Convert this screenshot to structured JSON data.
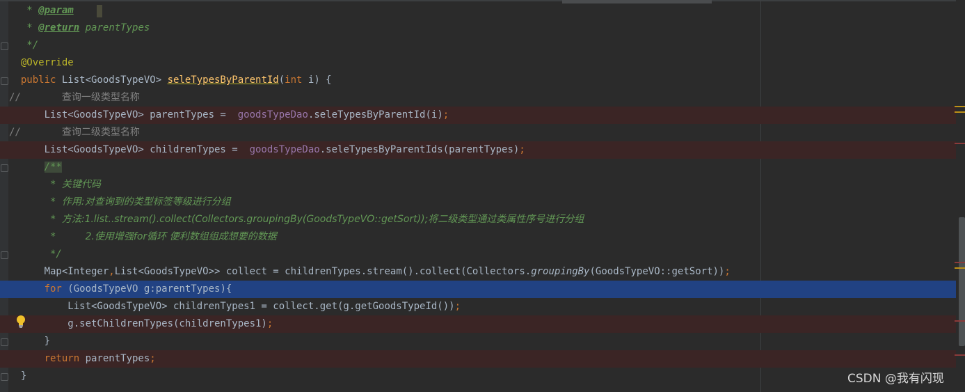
{
  "editor": {
    "lines": [
      {
        "id": "l1",
        "parts": [
          {
            "c": "doc",
            "t": "   * "
          },
          {
            "c": "doctag",
            "t": "@param"
          },
          {
            "c": "doc",
            "t": " "
          }
        ]
      },
      {
        "id": "l2",
        "parts": [
          {
            "c": "doc",
            "t": "   * "
          },
          {
            "c": "doctag",
            "t": "@return"
          },
          {
            "c": "doc",
            "t": " parentTypes"
          }
        ]
      },
      {
        "id": "l3",
        "parts": [
          {
            "c": "doc",
            "t": "   */"
          }
        ]
      },
      {
        "id": "l4",
        "parts": [
          {
            "c": "ann",
            "t": "  @Override"
          }
        ]
      },
      {
        "id": "l5",
        "parts": [
          {
            "c": "kw",
            "t": "  public "
          },
          {
            "c": "",
            "t": "List<GoodsTypeVO> "
          },
          {
            "c": "fn",
            "t": "seleTypesByParentId"
          },
          {
            "c": "",
            "t": "("
          },
          {
            "c": "kw",
            "t": "int "
          },
          {
            "c": "",
            "t": "i) {"
          }
        ]
      },
      {
        "id": "l6",
        "parts": [
          {
            "c": "cmt",
            "t": "//       "
          },
          {
            "c": "cmt cjk",
            "t": "查询一级类型名称"
          }
        ]
      },
      {
        "id": "l7",
        "err": true,
        "parts": [
          {
            "c": "",
            "t": "      List<GoodsTypeVO> parentTypes =  "
          },
          {
            "c": "fld",
            "t": "goodsTypeDao"
          },
          {
            "c": "",
            "t": ".seleTypesByParentId(i)"
          },
          {
            "c": "kw",
            "t": ";"
          }
        ]
      },
      {
        "id": "l8",
        "parts": [
          {
            "c": "cmt",
            "t": "//       "
          },
          {
            "c": "cmt cjk",
            "t": "查询二级类型名称"
          }
        ]
      },
      {
        "id": "l9",
        "err": true,
        "parts": [
          {
            "c": "",
            "t": "      List<GoodsTypeVO> childrenTypes =  "
          },
          {
            "c": "fld",
            "t": "goodsTypeDao"
          },
          {
            "c": "",
            "t": ".seleTypesByParentIds(parentTypes)"
          },
          {
            "c": "kw",
            "t": ";"
          }
        ]
      },
      {
        "id": "l10",
        "parts": [
          {
            "c": "",
            "t": "      "
          },
          {
            "c": "doc docbox",
            "t": "/**"
          }
        ]
      },
      {
        "id": "l11",
        "parts": [
          {
            "c": "doc",
            "t": "       * "
          },
          {
            "c": "doc cjk",
            "t": "关键代码"
          }
        ]
      },
      {
        "id": "l12",
        "parts": [
          {
            "c": "doc",
            "t": "       * "
          },
          {
            "c": "doc cjk",
            "t": "作用:对查询到的类型标签等级进行分组"
          }
        ]
      },
      {
        "id": "l13",
        "parts": [
          {
            "c": "doc",
            "t": "       * "
          },
          {
            "c": "doc cjk",
            "t": "方法:1.list..stream().collect(Collectors.groupingBy(GoodsTypeVO::getSort));将二级类型通过类属性序号进行分组"
          }
        ]
      },
      {
        "id": "l14",
        "parts": [
          {
            "c": "doc",
            "t": "       *     "
          },
          {
            "c": "doc cjk",
            "t": "2.使用增强for循环 便利数组组成想要的数据"
          }
        ]
      },
      {
        "id": "l15",
        "parts": [
          {
            "c": "doc",
            "t": "       */"
          }
        ]
      },
      {
        "id": "l16",
        "parts": [
          {
            "c": "",
            "t": "      Map<Integer"
          },
          {
            "c": "kw",
            "t": ","
          },
          {
            "c": "",
            "t": "List<GoodsTypeVO>> collect = childrenTypes.stream().collect(Collectors."
          },
          {
            "c": "it",
            "t": "groupingBy"
          },
          {
            "c": "",
            "t": "(GoodsTypeVO::getSort))"
          },
          {
            "c": "kw",
            "t": ";"
          }
        ]
      },
      {
        "id": "l17",
        "sel": true,
        "parts": [
          {
            "c": "kw",
            "t": "      for "
          },
          {
            "c": "",
            "t": "(GoodsTypeVO g:parentTypes){"
          }
        ]
      },
      {
        "id": "l18",
        "parts": [
          {
            "c": "",
            "t": "          List<GoodsTypeVO> childrenTypes1 = collect.get(g.getGoodsTypeId())"
          },
          {
            "c": "kw",
            "t": ";"
          }
        ]
      },
      {
        "id": "l19",
        "err": true,
        "parts": [
          {
            "c": "",
            "t": "          g.setChildrenTypes(childrenTypes1)"
          },
          {
            "c": "kw",
            "t": ";"
          }
        ]
      },
      {
        "id": "l20",
        "parts": [
          {
            "c": "",
            "t": "      }"
          }
        ]
      },
      {
        "id": "l21",
        "err": true,
        "parts": [
          {
            "c": "kw",
            "t": "      return "
          },
          {
            "c": "",
            "t": "parentTypes"
          },
          {
            "c": "kw",
            "t": ";"
          }
        ]
      },
      {
        "id": "l22",
        "parts": [
          {
            "c": "",
            "t": "  }"
          }
        ]
      }
    ],
    "folds": [
      "l3",
      "l5",
      "l10",
      "l15",
      "l20",
      "l22"
    ],
    "bulb_icon": "lightbulb-icon"
  },
  "watermark": "CSDN @我有闪现",
  "colors": {
    "error_line": "#3b2525",
    "selection": "#214283",
    "marker_warning": "#be9117",
    "marker_error": "#8c3a3a"
  }
}
